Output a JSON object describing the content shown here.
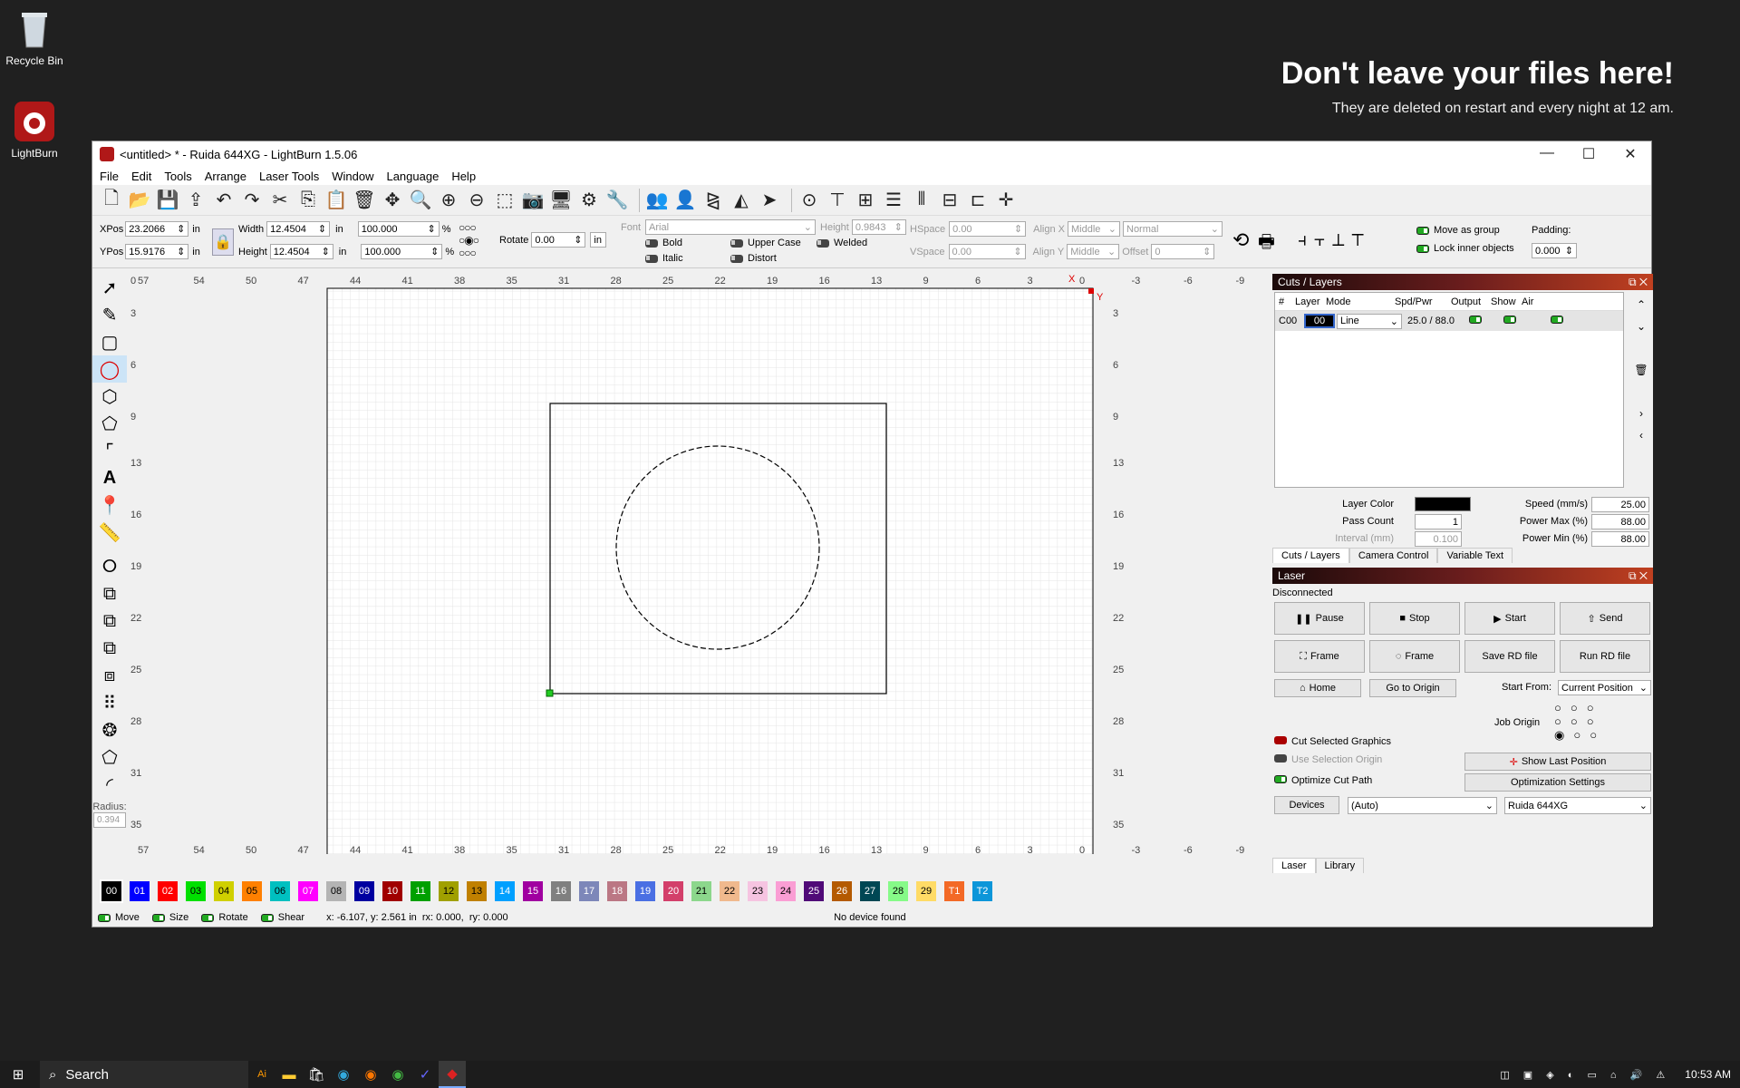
{
  "desktop": {
    "recycle_bin": "Recycle Bin",
    "lightburn": "LightBurn",
    "banner_title": "Don't leave your files here!",
    "banner_sub": "They are deleted on restart and every night at 12 am."
  },
  "window": {
    "title": "<untitled> * - Ruida 644XG - LightBurn 1.5.06",
    "minimize": "—",
    "maximize": "☐",
    "close": "✕"
  },
  "menu": [
    "File",
    "Edit",
    "Tools",
    "Arrange",
    "Laser Tools",
    "Window",
    "Language",
    "Help"
  ],
  "props": {
    "xpos_label": "XPos",
    "xpos": "23.2066",
    "ypos_label": "YPos",
    "ypos": "15.9176",
    "unit": "in",
    "width_label": "Width",
    "width": "12.4504",
    "height_label": "Height",
    "height": "12.4504",
    "scale_w": "100.000",
    "scale_h": "100.000",
    "pct": "%",
    "rotate_label": "Rotate",
    "rotate": "0.00",
    "rot_unit": "in",
    "font_label": "Font",
    "font": "Arial",
    "fheight_label": "Height",
    "fheight": "0.9843",
    "hspace_label": "HSpace",
    "hspace": "0.00",
    "vspace_label": "VSpace",
    "vspace": "0.00",
    "alignx_label": "Align X",
    "alignx": "Middle",
    "aligny_label": "Align Y",
    "aligny": "Middle",
    "normal": "Normal",
    "offset_label": "Offset",
    "offset": "0",
    "bold": "Bold",
    "italic": "Italic",
    "upper": "Upper Case",
    "distort": "Distort",
    "welded": "Welded",
    "move_group": "Move as group",
    "lock_inner": "Lock inner objects",
    "padding_label": "Padding:",
    "padding": "0.000"
  },
  "canvas": {
    "top_ticks": [
      "57",
      "54",
      "50",
      "47",
      "44",
      "41",
      "38",
      "35",
      "31",
      "28",
      "25",
      "22",
      "19",
      "16",
      "13",
      "9",
      "6",
      "3",
      "0",
      "-3",
      "-6",
      "-9"
    ],
    "left_ticks": [
      "0",
      "3",
      "6",
      "9",
      "13",
      "16",
      "19",
      "22",
      "25",
      "28",
      "31",
      "35"
    ],
    "x_marker": "X",
    "y_marker": "Y"
  },
  "radius": {
    "label": "Radius:",
    "value": "0.394"
  },
  "cuts": {
    "title": "Cuts / Layers",
    "headers": [
      "#",
      "Layer",
      "Mode",
      "Spd/Pwr",
      "Output",
      "Show",
      "Air"
    ],
    "row": {
      "num": "C00",
      "layer": "00",
      "mode": "Line",
      "spd": "25.0 / 88.0"
    },
    "layer_color_label": "Layer Color",
    "speed_label": "Speed (mm/s)",
    "speed": "25.00",
    "pass_label": "Pass Count",
    "pass": "1",
    "pmax_label": "Power Max (%)",
    "pmax": "88.00",
    "interval_label": "Interval (mm)",
    "interval": "0.100",
    "pmin_label": "Power Min (%)",
    "pmin": "88.00",
    "tabs": [
      "Cuts / Layers",
      "Camera Control",
      "Variable Text"
    ]
  },
  "laser": {
    "title": "Laser",
    "status": "Disconnected",
    "pause": "Pause",
    "stop": "Stop",
    "start": "Start",
    "send": "Send",
    "frame1": "Frame",
    "frame2": "Frame",
    "save_rd": "Save RD file",
    "run_rd": "Run RD file",
    "home": "Home",
    "go_origin": "Go to Origin",
    "start_from_label": "Start From:",
    "start_from": "Current Position",
    "job_origin": "Job Origin",
    "cut_selected": "Cut Selected Graphics",
    "use_sel": "Use Selection Origin",
    "optimize": "Optimize Cut Path",
    "show_last": "Show Last Position",
    "opt_settings": "Optimization Settings",
    "devices": "Devices",
    "auto": "(Auto)",
    "device": "Ruida 644XG",
    "tabs": [
      "Laser",
      "Library"
    ]
  },
  "palette": [
    {
      "l": "00",
      "c": "#000000",
      "t": "#fff"
    },
    {
      "l": "01",
      "c": "#0000ff",
      "t": "#fff"
    },
    {
      "l": "02",
      "c": "#ff0000",
      "t": "#fff"
    },
    {
      "l": "03",
      "c": "#00e000",
      "t": "#000"
    },
    {
      "l": "04",
      "c": "#d0d000",
      "t": "#000"
    },
    {
      "l": "05",
      "c": "#ff8000",
      "t": "#000"
    },
    {
      "l": "06",
      "c": "#00c0c0",
      "t": "#000"
    },
    {
      "l": "07",
      "c": "#ff00ff",
      "t": "#fff"
    },
    {
      "l": "08",
      "c": "#b4b4b4",
      "t": "#000"
    },
    {
      "l": "09",
      "c": "#0000a0",
      "t": "#fff"
    },
    {
      "l": "10",
      "c": "#a00000",
      "t": "#fff"
    },
    {
      "l": "11",
      "c": "#00a000",
      "t": "#fff"
    },
    {
      "l": "12",
      "c": "#a0a000",
      "t": "#000"
    },
    {
      "l": "13",
      "c": "#c08000",
      "t": "#000"
    },
    {
      "l": "14",
      "c": "#00a0ff",
      "t": "#fff"
    },
    {
      "l": "15",
      "c": "#a000a0",
      "t": "#fff"
    },
    {
      "l": "16",
      "c": "#808080",
      "t": "#fff"
    },
    {
      "l": "17",
      "c": "#7d87b9",
      "t": "#fff"
    },
    {
      "l": "18",
      "c": "#bb7784",
      "t": "#fff"
    },
    {
      "l": "19",
      "c": "#4a6fe3",
      "t": "#fff"
    },
    {
      "l": "20",
      "c": "#d33f6a",
      "t": "#fff"
    },
    {
      "l": "21",
      "c": "#8cd78c",
      "t": "#000"
    },
    {
      "l": "22",
      "c": "#f0b98d",
      "t": "#000"
    },
    {
      "l": "23",
      "c": "#f6c4e1",
      "t": "#000"
    },
    {
      "l": "24",
      "c": "#fa9ed4",
      "t": "#000"
    },
    {
      "l": "25",
      "c": "#500a78",
      "t": "#fff"
    },
    {
      "l": "26",
      "c": "#b45a00",
      "t": "#fff"
    },
    {
      "l": "27",
      "c": "#004754",
      "t": "#fff"
    },
    {
      "l": "28",
      "c": "#86fa88",
      "t": "#000"
    },
    {
      "l": "29",
      "c": "#ffdb66",
      "t": "#000"
    },
    {
      "l": "T1",
      "c": "#f36926",
      "t": "#fff"
    },
    {
      "l": "T2",
      "c": "#0c96d9",
      "t": "#fff"
    }
  ],
  "status": {
    "move": "Move",
    "size": "Size",
    "rotate": "Rotate",
    "shear": "Shear",
    "coords": "x: -6.107, y: 2.561 in  rx: 0.000,  ry: 0.000",
    "device": "No device found"
  },
  "taskbar": {
    "search": "Search",
    "time": "10:53 AM"
  }
}
